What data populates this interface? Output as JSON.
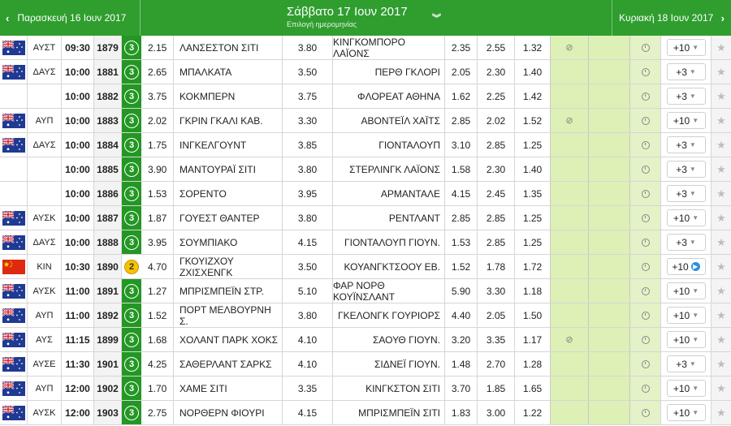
{
  "header": {
    "prev_day": "Παρασκευή 16 Ιουν 2017",
    "current_day": "Σάββατο 17 Ιουν 2017",
    "date_picker_label": "Επιλογή ημερομηνίας",
    "next_day": "Κυριακή 18 Ιουν 2017"
  },
  "rows": [
    {
      "flag": "au",
      "league": "ΑΥΣΤ",
      "time": "09:30",
      "code": "1879",
      "badge": "3",
      "o1": "2.15",
      "home": "ΛΑΝΣΕΣΤΟΝ ΣΙΤΙ",
      "ox": "3.80",
      "away": "ΚΙΝΓΚΟΜΠΟΡΟ ΛΑΪΟΝΣ",
      "o2": "2.35",
      "u": "2.55",
      "o": "1.32",
      "nolive": true,
      "more": "+10",
      "live": false
    },
    {
      "flag": "au",
      "league": "ΔΑΥΣ",
      "time": "10:00",
      "code": "1881",
      "badge": "3",
      "o1": "2.65",
      "home": "ΜΠΑΛΚΑΤΑ",
      "ox": "3.50",
      "away": "ΠΕΡΘ ΓΚΛΟΡΙ",
      "o2": "2.05",
      "u": "2.30",
      "o": "1.40",
      "nolive": false,
      "more": "+3",
      "live": false
    },
    {
      "flag": "",
      "league": "",
      "time": "10:00",
      "code": "1882",
      "badge": "3",
      "o1": "3.75",
      "home": "ΚΟΚΜΠΕΡΝ",
      "ox": "3.75",
      "away": "ΦΛΟΡΕΑΤ ΑΘΗΝΑ",
      "o2": "1.62",
      "u": "2.25",
      "o": "1.42",
      "nolive": false,
      "more": "+3",
      "live": false
    },
    {
      "flag": "au",
      "league": "ΑΥΠ",
      "time": "10:00",
      "code": "1883",
      "badge": "3",
      "o1": "2.02",
      "home": "ΓΚΡΙΝ ΓΚΑΛΙ ΚΑΒ.",
      "ox": "3.30",
      "away": "ΑΒΟΝΤΕΪΛ ΧΑΪΤΣ",
      "o2": "2.85",
      "u": "2.02",
      "o": "1.52",
      "nolive": true,
      "more": "+10",
      "live": false
    },
    {
      "flag": "au",
      "league": "ΔΑΥΣ",
      "time": "10:00",
      "code": "1884",
      "badge": "3",
      "o1": "1.75",
      "home": "ΙΝΓΚΕΛΓΟΥΝΤ",
      "ox": "3.85",
      "away": "ΓΙΟΝΤΑΛΟΥΠ",
      "o2": "3.10",
      "u": "2.85",
      "o": "1.25",
      "nolive": false,
      "more": "+3",
      "live": false
    },
    {
      "flag": "",
      "league": "",
      "time": "10:00",
      "code": "1885",
      "badge": "3",
      "o1": "3.90",
      "home": "ΜΑΝΤΟΥΡΑΪ ΣΙΤΙ",
      "ox": "3.80",
      "away": "ΣΤΕΡΛΙΝΓΚ ΛΑΪΟΝΣ",
      "o2": "1.58",
      "u": "2.30",
      "o": "1.40",
      "nolive": false,
      "more": "+3",
      "live": false
    },
    {
      "flag": "",
      "league": "",
      "time": "10:00",
      "code": "1886",
      "badge": "3",
      "o1": "1.53",
      "home": "ΣΟΡΕΝΤΟ",
      "ox": "3.95",
      "away": "ΑΡΜΑΝΤΑΛΕ",
      "o2": "4.15",
      "u": "2.45",
      "o": "1.35",
      "nolive": false,
      "more": "+3",
      "live": false
    },
    {
      "flag": "au",
      "league": "ΑΥΣΚ",
      "time": "10:00",
      "code": "1887",
      "badge": "3",
      "o1": "1.87",
      "home": "ΓΟΥΕΣΤ ΘΑΝΤΕΡ",
      "ox": "3.80",
      "away": "ΡΕΝΤΛΑΝΤ",
      "o2": "2.85",
      "u": "2.85",
      "o": "1.25",
      "nolive": false,
      "more": "+10",
      "live": false
    },
    {
      "flag": "au",
      "league": "ΔΑΥΣ",
      "time": "10:00",
      "code": "1888",
      "badge": "3",
      "o1": "3.95",
      "home": "ΣΟΥΜΠΙΑΚΟ",
      "ox": "4.15",
      "away": "ΓΙΟΝΤΑΛΟΥΠ ΓΙΟΥΝ.",
      "o2": "1.53",
      "u": "2.85",
      "o": "1.25",
      "nolive": false,
      "more": "+3",
      "live": false
    },
    {
      "flag": "cn",
      "league": "ΚΙΝ",
      "time": "10:30",
      "code": "1890",
      "badge": "2",
      "o1": "4.70",
      "home": "ΓΚΟΥΙΖΧΟΥ ΖΧΙΣΧΕΝΓΚ",
      "ox": "3.50",
      "away": "ΚΟΥΑΝΓΚΤΣΟΟΥ ΕΒ.",
      "o2": "1.52",
      "u": "1.78",
      "o": "1.72",
      "nolive": false,
      "more": "+10",
      "live": true
    },
    {
      "flag": "au",
      "league": "ΑΥΣΚ",
      "time": "11:00",
      "code": "1891",
      "badge": "3",
      "o1": "1.27",
      "home": "ΜΠΡΙΣΜΠΕΪΝ ΣΤΡ.",
      "ox": "5.10",
      "away": "ΦΑΡ ΝΟΡΘ ΚΟΥΪΝΣΛΑΝΤ",
      "o2": "5.90",
      "u": "3.30",
      "o": "1.18",
      "nolive": false,
      "more": "+10",
      "live": false
    },
    {
      "flag": "au",
      "league": "ΑΥΠ",
      "time": "11:00",
      "code": "1892",
      "badge": "3",
      "o1": "1.52",
      "home": "ΠΟΡΤ ΜΕΛΒΟΥΡΝΗ Σ.",
      "ox": "3.80",
      "away": "ΓΚΕΛΟΝΓΚ ΓΟΥΡΙΟΡΣ",
      "o2": "4.40",
      "u": "2.05",
      "o": "1.50",
      "nolive": false,
      "more": "+10",
      "live": false
    },
    {
      "flag": "au",
      "league": "ΑΥΣ",
      "time": "11:15",
      "code": "1899",
      "badge": "3",
      "o1": "1.68",
      "home": "ΧΟΛΑΝΤ ΠΑΡΚ ΧΟΚΣ",
      "ox": "4.10",
      "away": "ΣΑΟΥΘ ΓΙΟΥΝ.",
      "o2": "3.20",
      "u": "3.35",
      "o": "1.17",
      "nolive": true,
      "more": "+10",
      "live": false
    },
    {
      "flag": "au",
      "league": "ΑΥΣΕ",
      "time": "11:30",
      "code": "1901",
      "badge": "3",
      "o1": "4.25",
      "home": "ΣΑΘΕΡΛΑΝΤ ΣΑΡΚΣ",
      "ox": "4.10",
      "away": "ΣΙΔΝΕΪ ΓΙΟΥΝ.",
      "o2": "1.48",
      "u": "2.70",
      "o": "1.28",
      "nolive": false,
      "more": "+3",
      "live": false
    },
    {
      "flag": "au",
      "league": "ΑΥΠ",
      "time": "12:00",
      "code": "1902",
      "badge": "3",
      "o1": "1.70",
      "home": "ΧΑΜΕ ΣΙΤΙ",
      "ox": "3.35",
      "away": "ΚΙΝΓΚΣΤΟΝ ΣΙΤΙ",
      "o2": "3.70",
      "u": "1.85",
      "o": "1.65",
      "nolive": false,
      "more": "+10",
      "live": false
    },
    {
      "flag": "au",
      "league": "ΑΥΣΚ",
      "time": "12:00",
      "code": "1903",
      "badge": "3",
      "o1": "2.75",
      "home": "ΝΟΡΘΕΡΝ ΦΙΟΥΡΙ",
      "ox": "4.15",
      "away": "ΜΠΡΙΣΜΠΕΪΝ ΣΙΤΙ",
      "o2": "1.83",
      "u": "3.00",
      "o": "1.22",
      "nolive": false,
      "more": "+10",
      "live": false
    }
  ],
  "colors": {
    "header_green": "#2f9e2f",
    "badge_green": "#239723",
    "highlight_green": "#ddf0b6",
    "badge_yellow": "#f5c400",
    "live_blue": "#2c8ee0"
  },
  "icons": {
    "prev": "chevron-left-icon",
    "next": "chevron-right-icon",
    "date_dropdown": "double-chevron-down-icon",
    "clock": "clock-icon",
    "favourite": "star-icon",
    "no_live": "no-live-stream-icon",
    "live": "live-play-icon"
  }
}
